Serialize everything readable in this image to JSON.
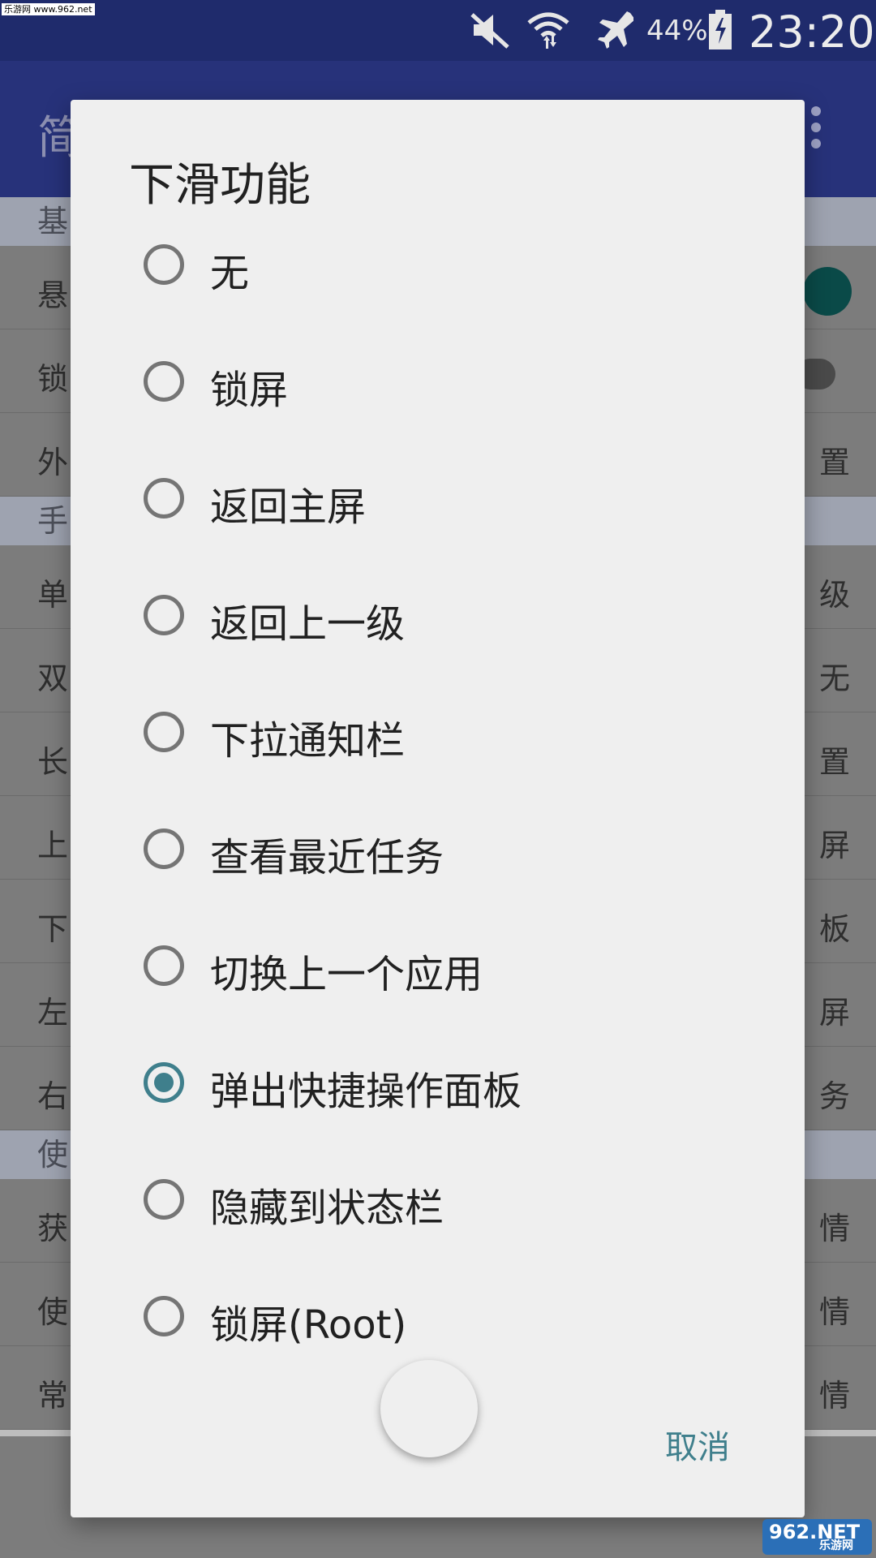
{
  "status_bar": {
    "watermark": "乐游网 www.962.net",
    "battery_percent": "44%",
    "time": "23:20",
    "icons": [
      "mute-icon",
      "wifi-icon",
      "airplane-icon",
      "battery-charging-icon"
    ]
  },
  "app_bar": {
    "title": "简",
    "menu_icon": "more-vert-icon"
  },
  "background_list": {
    "sections": [
      "基",
      "手",
      "使"
    ],
    "rows_group1": [
      {
        "label": "悬",
        "value": ""
      },
      {
        "label": "锁",
        "value": ""
      },
      {
        "label": "外",
        "value": "置"
      }
    ],
    "rows_group2": [
      {
        "label": "单",
        "value": "级"
      },
      {
        "label": "双",
        "value": "无"
      },
      {
        "label": "长",
        "value": "置"
      },
      {
        "label": "上",
        "value": "屏"
      },
      {
        "label": "下",
        "value": "板"
      },
      {
        "label": "左",
        "value": "屏"
      },
      {
        "label": "右",
        "value": "务"
      }
    ],
    "rows_group3": [
      {
        "label": "获",
        "value": "情"
      },
      {
        "label": "使",
        "value": "情"
      },
      {
        "label": "常",
        "value": "情"
      }
    ]
  },
  "dialog": {
    "title": "下滑功能",
    "options": [
      {
        "label": "无",
        "selected": false
      },
      {
        "label": "锁屏",
        "selected": false
      },
      {
        "label": "返回主屏",
        "selected": false
      },
      {
        "label": "返回上一级",
        "selected": false
      },
      {
        "label": "下拉通知栏",
        "selected": false
      },
      {
        "label": "查看最近任务",
        "selected": false
      },
      {
        "label": "切换上一个应用",
        "selected": false
      },
      {
        "label": "弹出快捷操作面板",
        "selected": true
      },
      {
        "label": "隐藏到状态栏",
        "selected": false
      },
      {
        "label": "锁屏(Root)",
        "selected": false
      }
    ],
    "cancel_label": "取消"
  },
  "logo_watermark": {
    "main": "962.NET",
    "sub": "乐游网"
  },
  "colors": {
    "accent": "#3f7f8c",
    "status_bar": "#1f2b6c",
    "app_bar": "#27327a"
  }
}
